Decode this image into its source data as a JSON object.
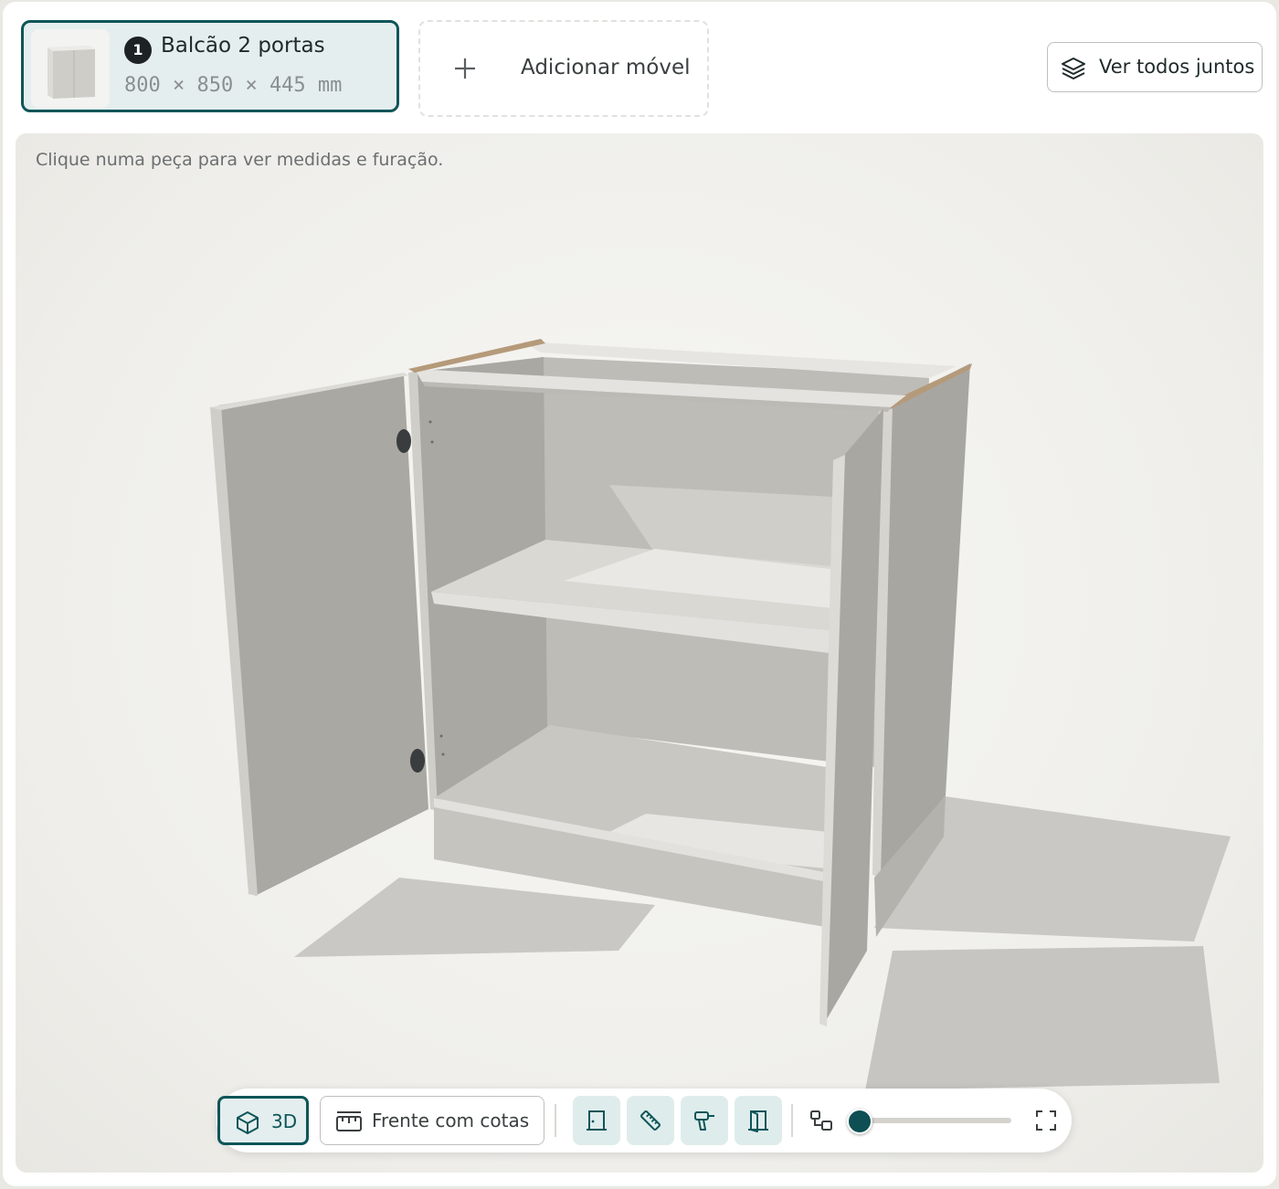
{
  "furniture_tab": {
    "index": "1",
    "title": "Balcão 2 portas",
    "dimensions": "800 × 850 × 445 mm"
  },
  "add_button": {
    "label": "Adicionar móvel",
    "icon": "plus-icon"
  },
  "view_all_button": {
    "label": "Ver todos juntos",
    "icon": "layers-icon"
  },
  "viewer": {
    "hint": "Clique numa peça para ver medidas e furação."
  },
  "toolbar": {
    "view_3d_label": "3D",
    "front_view_label": "Frente com cotas",
    "zoom_level": 0.0,
    "icons": [
      "cube-icon",
      "ruler-frame-icon",
      "door-panel-icon",
      "ruler-icon",
      "drill-icon",
      "open-door-icon",
      "explode-icon",
      "fullscreen-icon"
    ]
  },
  "colors": {
    "accent": "#0d5558",
    "accent_light": "#e4eeee",
    "panel": "#c8c7c2",
    "edge_wood": "#b59a7a"
  }
}
